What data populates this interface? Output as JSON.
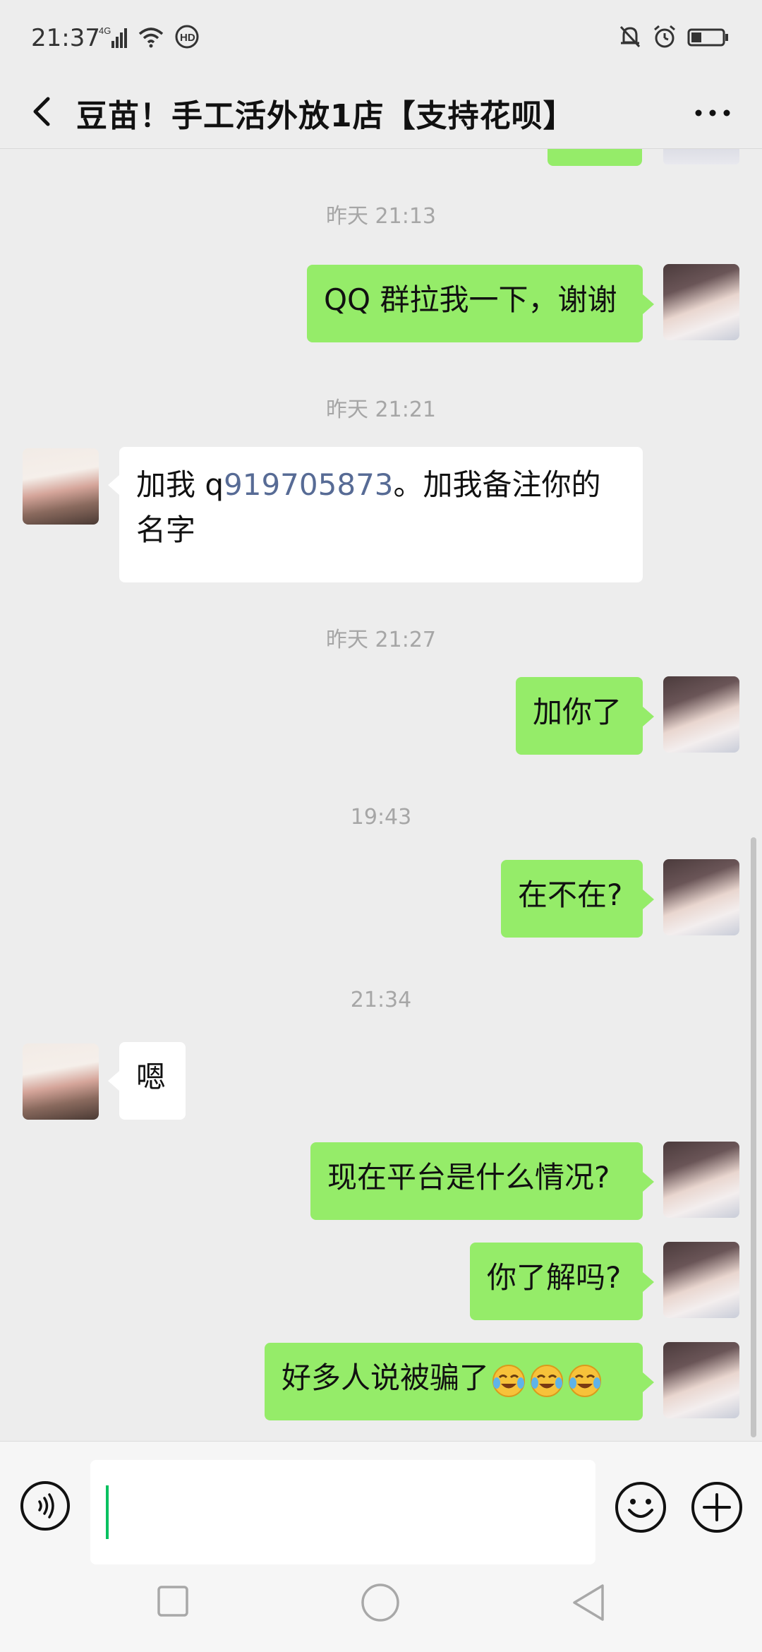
{
  "status_bar": {
    "time": "21:37",
    "network": "4G",
    "hd": "HD"
  },
  "header": {
    "title": "豆苗！手工活外放1店【支持花呗】"
  },
  "messages": [
    {
      "type": "timestamp",
      "text": "昨天 21:13"
    },
    {
      "type": "msg",
      "side": "right",
      "text": "QQ 群拉我一下，谢谢"
    },
    {
      "type": "timestamp",
      "text": "昨天 21:21"
    },
    {
      "type": "msg",
      "side": "left",
      "line1_prefix": "加我 q",
      "qq_number": "919705873",
      "line1_suffix": "。加我备注你的",
      "line2": "名字"
    },
    {
      "type": "timestamp",
      "text": "昨天 21:27"
    },
    {
      "type": "msg",
      "side": "right",
      "text": "加你了"
    },
    {
      "type": "timestamp",
      "text": "19:43"
    },
    {
      "type": "msg",
      "side": "right",
      "text": "在不在?"
    },
    {
      "type": "timestamp",
      "text": "21:34"
    },
    {
      "type": "msg",
      "side": "left",
      "text": "嗯"
    },
    {
      "type": "msg",
      "side": "right",
      "text": "现在平台是什么情况?"
    },
    {
      "type": "msg",
      "side": "right",
      "text": "你了解吗?"
    },
    {
      "type": "msg",
      "side": "right",
      "text": "好多人说被骗了",
      "emoji_count": 3,
      "emoji_name": "laughing-crying-emoji"
    }
  ],
  "colors": {
    "chat_bg": "#ededed",
    "bubble_self": "#95ec69",
    "bubble_other": "#ffffff",
    "link": "#576b95",
    "timestamp": "#a6a6a6",
    "cursor": "#07c160"
  },
  "icons": {
    "back": "chevron-left-icon",
    "more": "more-dots-icon",
    "voice": "voice-icon",
    "emoji": "smiley-icon",
    "plus": "plus-icon"
  }
}
